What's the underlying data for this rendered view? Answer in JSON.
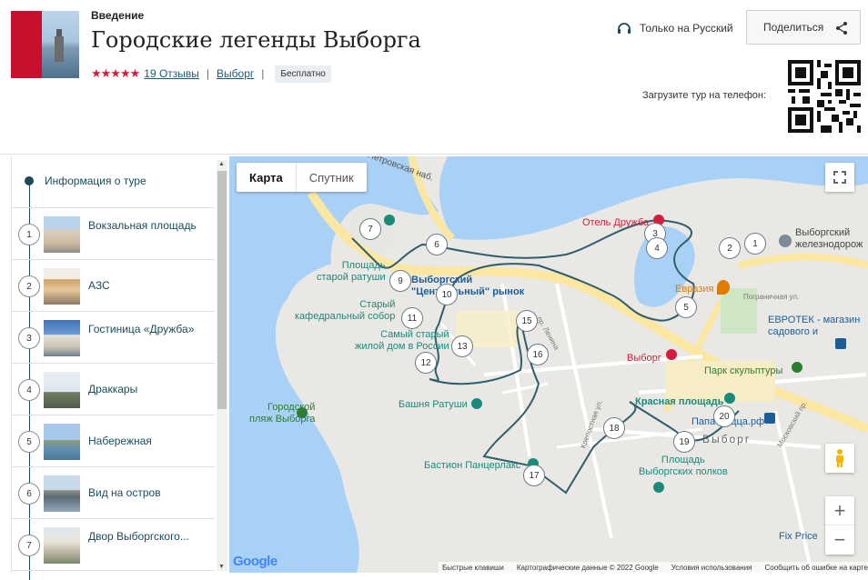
{
  "header": {
    "kicker": "Введение",
    "title": "Городские легенды Выборга",
    "stars": "★★★★★",
    "reviews": "19 Отзывы",
    "city": "Выборг",
    "price_badge": "Бесплатно",
    "language": "Только на Русский",
    "share": "Поделиться",
    "download": "Загрузите тур на телефон:"
  },
  "sidebar": {
    "info_label": "Информация о туре",
    "stops": [
      {
        "num": "1",
        "label": "Вокзальная площадь"
      },
      {
        "num": "2",
        "label": "АЗС"
      },
      {
        "num": "3",
        "label": "Гостиница «Дружба»"
      },
      {
        "num": "4",
        "label": "Драккары"
      },
      {
        "num": "5",
        "label": "Набережная"
      },
      {
        "num": "6",
        "label": "Вид на остров"
      },
      {
        "num": "7",
        "label": "Двор Выборгского..."
      }
    ]
  },
  "map": {
    "type_map": "Карта",
    "type_satellite": "Спутник",
    "zoom_in": "+",
    "zoom_out": "−",
    "google": "Google",
    "footer": {
      "shortcuts": "Быстрые клавиши",
      "data": "Картографические данные © 2022 Google",
      "terms": "Условия использования",
      "report": "Сообщить об ошибке на карте"
    },
    "labels": {
      "petrovskaya": "Петровская наб.",
      "vyborgsky": "Выборгский",
      "zheleznodor": "железнодорож",
      "hotel": "Отель Дружба",
      "square_ratusha_1": "Площадь",
      "square_ratusha_2": "старой ратуши",
      "market_1": "Выборгский",
      "market_2": "\"Центральный\" рынок",
      "cathedral_1": "Старый",
      "cathedral_2": "кафедральный собор",
      "oldhouse_1": "Самый старый",
      "oldhouse_2": "жилой дом в России",
      "eurasia": "Евразия",
      "evrotek_1": "ЕВРОТЕК - магазин",
      "evrotek_2": "садового и",
      "vyborg_poi": "Выборг",
      "sculpture_park": "Парк скульптуры",
      "red_square": "Красная площадь",
      "papa": "Папа Пицца.рф",
      "beach_1": "Городской",
      "beach_2": "пляж Выборга",
      "tower": "Башня Ратуши",
      "bastion": "Бастион Панцерлакс",
      "vyborg_city": "Выборг",
      "polkov_1": "Площадь",
      "polkov_2": "Выборгских полков",
      "fixprice": "Fix Price",
      "pogranichnaya": "Пограничная ул.",
      "kreposnaya": "Крепостная ул.",
      "moskovsky": "Московский пр.",
      "lenina": "пр. Ленина"
    },
    "markers": [
      "1",
      "2",
      "3",
      "4",
      "5",
      "6",
      "7",
      "9",
      "10",
      "11",
      "12",
      "13",
      "15",
      "16",
      "17",
      "18",
      "19",
      "20"
    ]
  },
  "colors": {
    "accent": "#d81b3c",
    "teal": "#1b4b5a",
    "water": "#a9d1f5",
    "route": "#2f5d6b"
  }
}
